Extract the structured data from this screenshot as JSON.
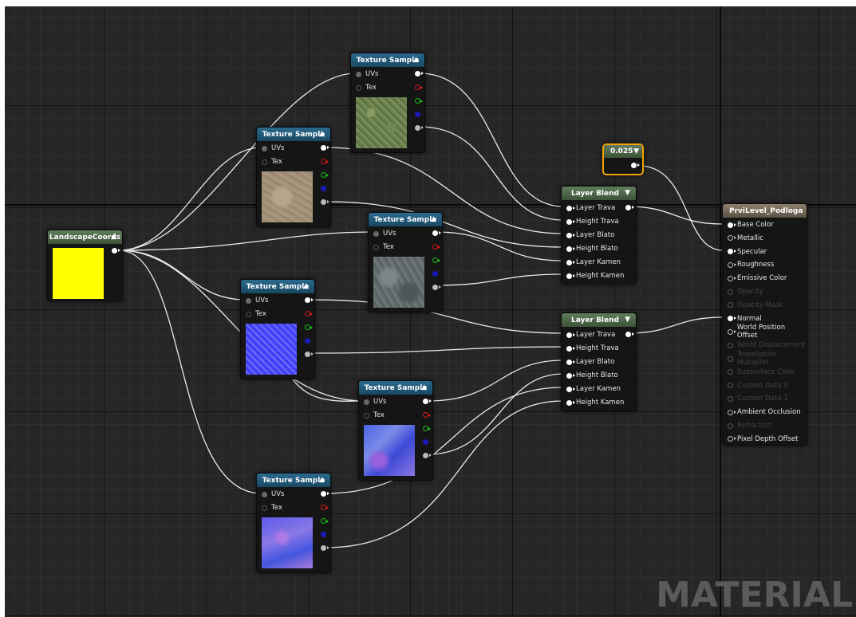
{
  "nodes": {
    "landscape_coords": {
      "title": "LandscapeCoords"
    },
    "texture_sample": {
      "title": "Texture Sample",
      "uvs": "UVs",
      "tex": "Tex"
    },
    "layer_blend": {
      "title": "Layer Blend",
      "inputs": [
        "Layer Trava",
        "Height Trava",
        "Layer Blato",
        "Height Blato",
        "Layer Kamen",
        "Height Kamen"
      ]
    },
    "constant": {
      "value": "0.025"
    },
    "material": {
      "title": "PrviLevel_Podloga",
      "inputs": [
        {
          "label": "Base Color",
          "enabled": true,
          "connected": true
        },
        {
          "label": "Metallic",
          "enabled": true,
          "connected": false
        },
        {
          "label": "Specular",
          "enabled": true,
          "connected": true
        },
        {
          "label": "Roughness",
          "enabled": true,
          "connected": false
        },
        {
          "label": "Emissive Color",
          "enabled": true,
          "connected": false
        },
        {
          "label": "Opacity",
          "enabled": false,
          "connected": false
        },
        {
          "label": "Opacity Mask",
          "enabled": false,
          "connected": false
        },
        {
          "label": "Normal",
          "enabled": true,
          "connected": true
        },
        {
          "label": "World Position Offset",
          "enabled": true,
          "connected": false
        },
        {
          "label": "World Displacement",
          "enabled": false,
          "connected": false
        },
        {
          "label": "Tessellation Multiplier",
          "enabled": false,
          "connected": false
        },
        {
          "label": "Subsurface Color",
          "enabled": false,
          "connected": false
        },
        {
          "label": "Custom Data 0",
          "enabled": false,
          "connected": false
        },
        {
          "label": "Custom Data 1",
          "enabled": false,
          "connected": false
        },
        {
          "label": "Ambient Occlusion",
          "enabled": true,
          "connected": false
        },
        {
          "label": "Refraction",
          "enabled": false,
          "connected": false
        },
        {
          "label": "Pixel Depth Offset",
          "enabled": true,
          "connected": false
        }
      ]
    }
  },
  "watermark": "MATERIAL",
  "colors": {
    "pin_red": "#d81818",
    "pin_green": "#18c018",
    "pin_blue": "#1a1ab8",
    "wire": "#ffffff",
    "const_border": "#f2a000"
  }
}
